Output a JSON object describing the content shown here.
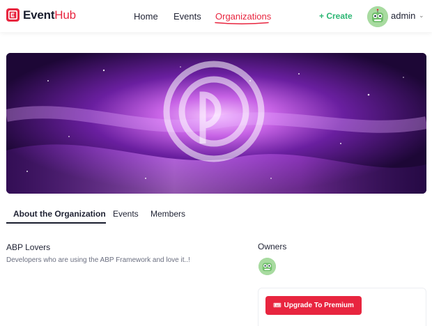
{
  "brand": {
    "name_bold": "Event",
    "name_light": "Hub",
    "accent": "#e8253f"
  },
  "nav": {
    "home": "Home",
    "events": "Events",
    "organizations": "Organizations",
    "active": "organizations"
  },
  "header": {
    "create_label": "+ Create",
    "user_name": "admin",
    "caret": "⌄"
  },
  "tabs": {
    "about": "About the Organization",
    "events": "Events",
    "members": "Members",
    "active": "about"
  },
  "organization": {
    "name": "ABP Lovers",
    "description": "Developers who are using the ABP Framework and love it..!"
  },
  "owners": {
    "title": "Owners"
  },
  "premium": {
    "label": "Upgrade To Premium",
    "icon": "ticket-icon"
  },
  "colors": {
    "create": "#2bb673",
    "primary_text": "#1f2233",
    "muted_text": "#6b6f80"
  }
}
